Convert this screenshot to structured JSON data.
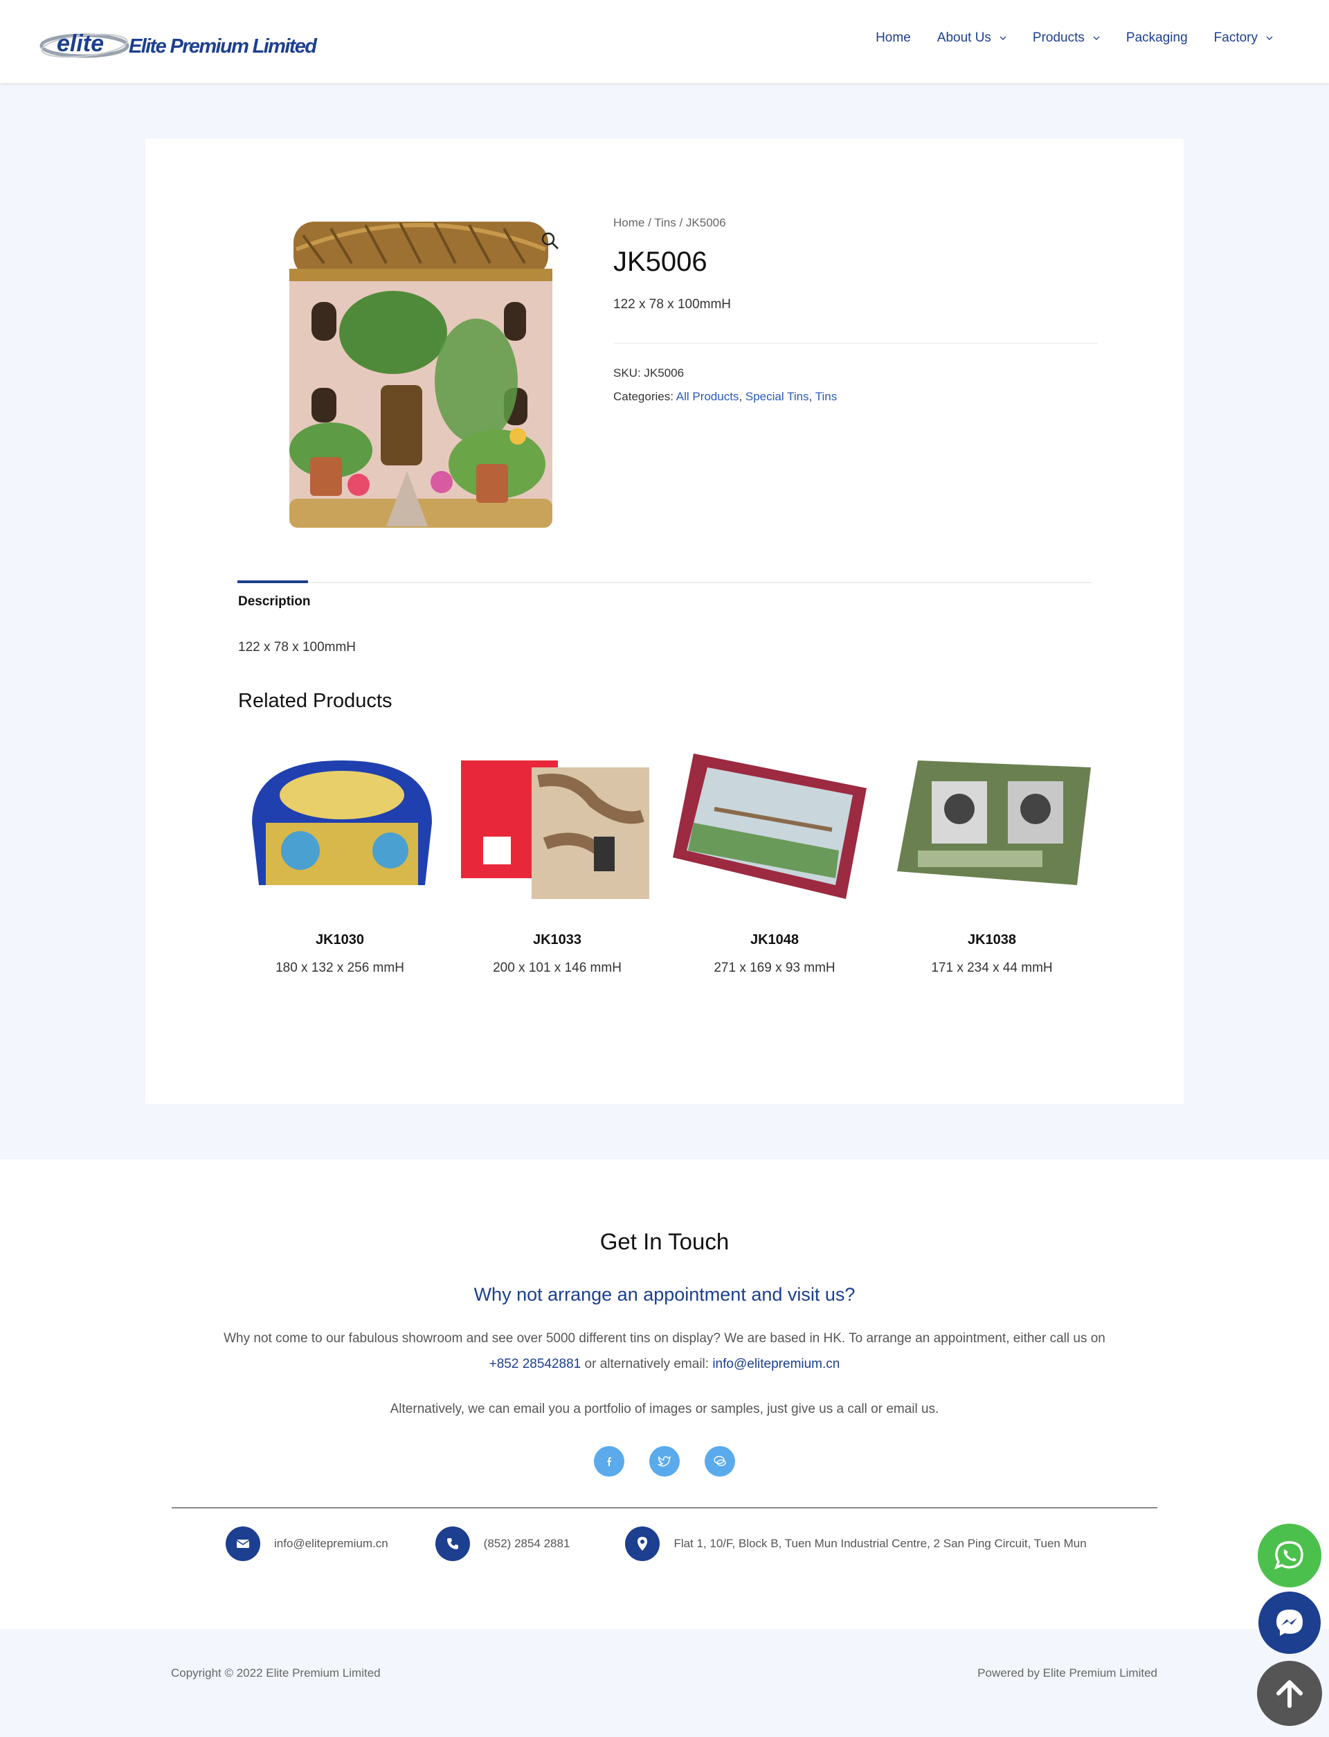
{
  "header": {
    "logo_mark": "elite",
    "logo_text": "Elite Premium Limited",
    "nav": [
      {
        "label": "Home",
        "has_dropdown": false
      },
      {
        "label": "About Us",
        "has_dropdown": true
      },
      {
        "label": "Products",
        "has_dropdown": true
      },
      {
        "label": "Packaging",
        "has_dropdown": false
      },
      {
        "label": "Factory",
        "has_dropdown": true
      }
    ]
  },
  "product": {
    "breadcrumb": {
      "home": "Home",
      "sep1": " / ",
      "category": "Tins",
      "sep2": " / ",
      "current": "JK5006"
    },
    "title": "JK5006",
    "short_description": "122 x 78 x 100mmH",
    "sku_label": "SKU: ",
    "sku": "JK5006",
    "categories_label": "Categories: ",
    "categories": [
      "All Products",
      "Special Tins",
      "Tins"
    ],
    "image_icon": "zoom-magnifier-icon"
  },
  "tabs": {
    "active": "Description",
    "description_text": "122 x 78 x 100mmH"
  },
  "related": {
    "title": "Related Products",
    "items": [
      {
        "name": "JK1030",
        "size": "180 x 132 x 256 mmH"
      },
      {
        "name": "JK1033",
        "size": "200 x 101 x 146 mmH"
      },
      {
        "name": "JK1048",
        "size": "271 x 169 x 93 mmH"
      },
      {
        "name": "JK1038",
        "size": "171 x 234 x 44 mmH"
      }
    ]
  },
  "contact": {
    "heading": "Get In Touch",
    "subheading": "Why not arrange an appointment and visit us?",
    "para_prefix": "Why not come to our fabulous showroom and see over 5000 different tins on display? We are based in HK. To arrange an appointment, either call us on ",
    "phone_link": "+852 28542881",
    "para_mid": " or alternatively email: ",
    "email_link": "info@elitepremium.cn",
    "para2": "Alternatively, we can email you a portfolio of images or samples, just give us a call or email us.",
    "socials": [
      "facebook-icon",
      "twitter-icon",
      "chat-icon"
    ],
    "info": {
      "email": "info@elitepremium.cn",
      "phone": "(852) 2854 2881",
      "address": "Flat 1, 10/F, Block B, Tuen Mun Industrial Centre, 2 San Ping Circuit, Tuen Mun"
    }
  },
  "footer": {
    "copyright": "Copyright © 2022 Elite Premium Limited",
    "powered": "Powered by Elite Premium Limited"
  },
  "colors": {
    "brand_blue": "#1c3f8f",
    "link_blue": "#2a5bb8",
    "whatsapp_green": "#4cc04c",
    "social_light_blue": "#5aaaec",
    "page_bg": "#f3f6fc"
  }
}
